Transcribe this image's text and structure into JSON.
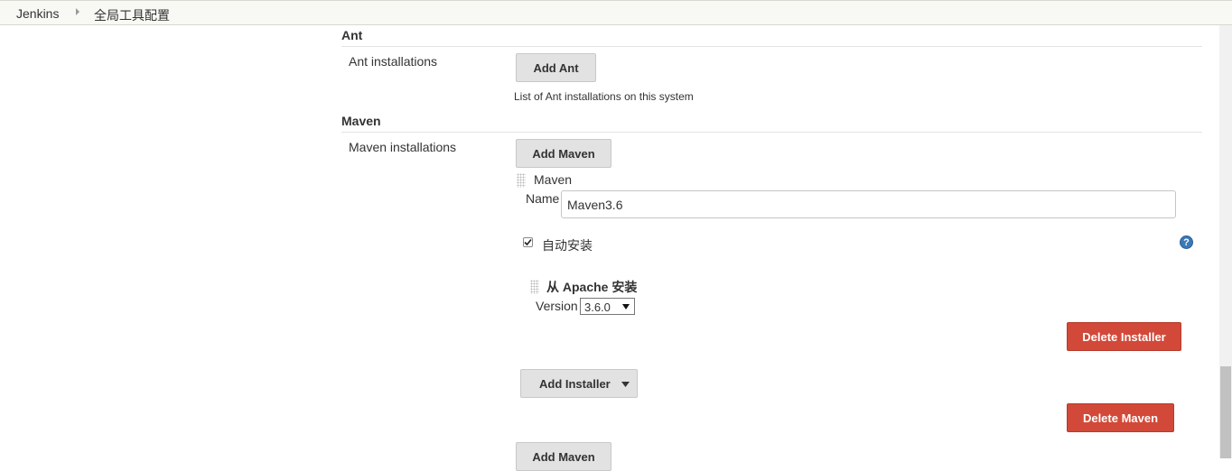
{
  "breadcrumb": {
    "items": [
      "Jenkins",
      "全局工具配置"
    ]
  },
  "ant": {
    "section_title": "Ant",
    "row_label": "Ant installations",
    "add_button": "Add Ant",
    "description": "List of Ant installations on this system"
  },
  "maven": {
    "section_title": "Maven",
    "row_label": "Maven installations",
    "add_button_top": "Add Maven",
    "block_title": "Maven",
    "name_label": "Name",
    "name_value": "Maven3.6",
    "auto_install_label": "自动安装",
    "auto_install_checked": true,
    "installer_title": "从 Apache 安装",
    "version_label": "Version",
    "version_value": "3.6.0",
    "delete_installer_button": "Delete Installer",
    "add_installer_button": "Add Installer",
    "delete_maven_button": "Delete Maven",
    "add_button_bottom": "Add Maven"
  },
  "colors": {
    "danger": "#d24939",
    "help": "#3a78b8"
  },
  "icons": {
    "help": "question-mark",
    "checkbox": "check-mark",
    "dropdown": "caret-down"
  }
}
